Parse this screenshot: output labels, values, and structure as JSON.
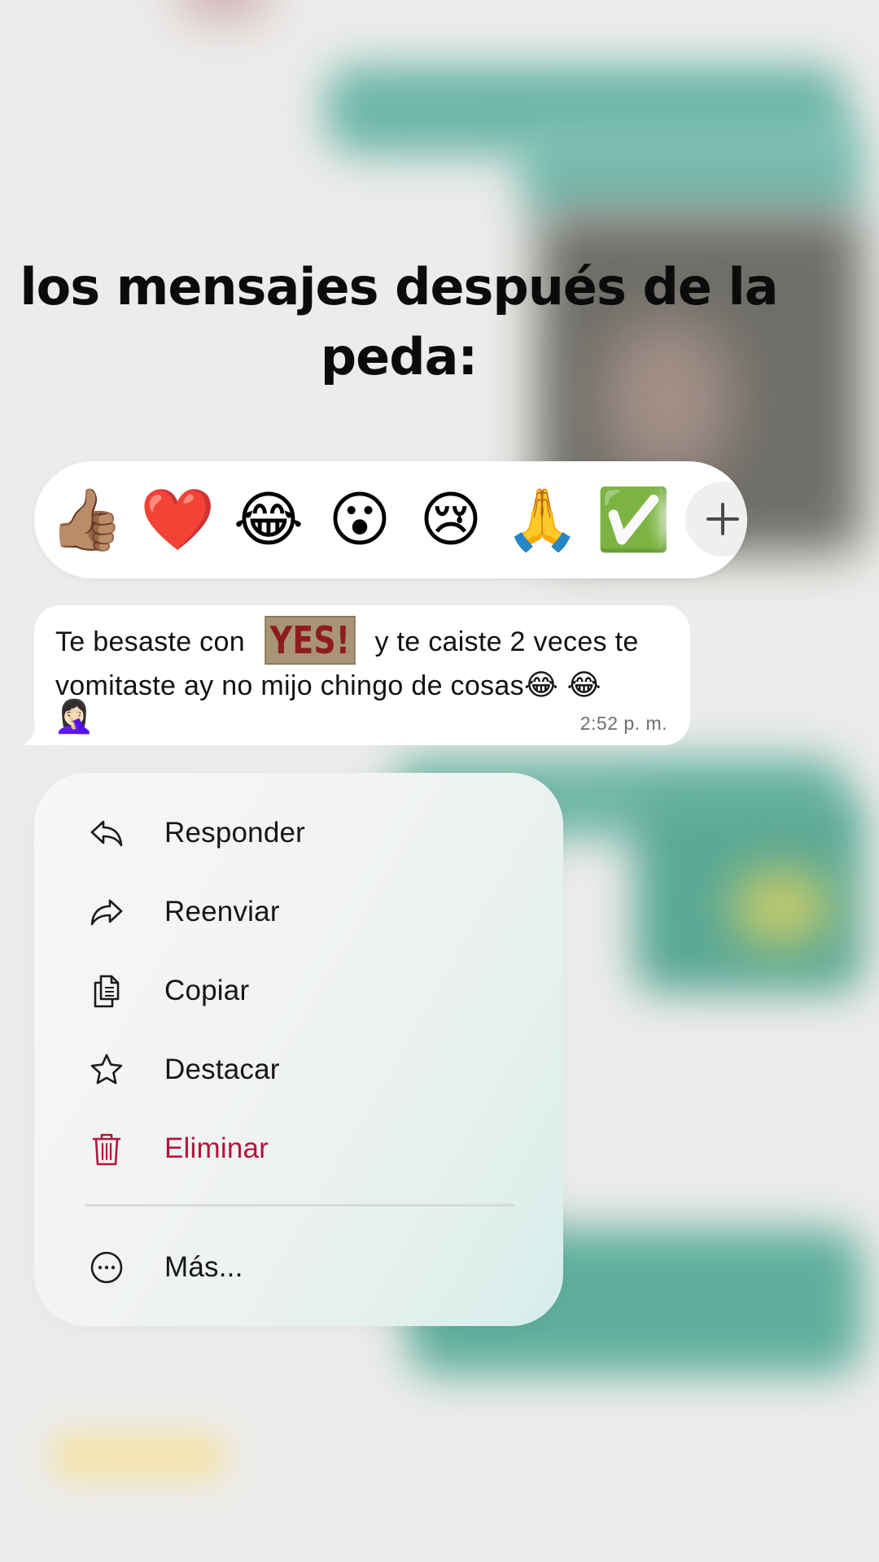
{
  "caption": {
    "line1": "los mensajes después de la",
    "line2": "peda:"
  },
  "reactions": [
    {
      "emoji": "👍🏽",
      "name": "thumbs-up"
    },
    {
      "emoji": "❤️",
      "name": "red-heart"
    },
    {
      "emoji": "😂",
      "name": "tears-of-joy"
    },
    {
      "emoji": "😮",
      "name": "surprised"
    },
    {
      "emoji": "😢",
      "name": "crying"
    },
    {
      "emoji": "🙏",
      "name": "folded-hands"
    },
    {
      "emoji": "✅",
      "name": "check-mark"
    }
  ],
  "reaction_add_icon": "plus-icon",
  "message": {
    "text_before_sticker": "Te besaste con ",
    "sticker_text": "YES!",
    "text_after_sticker": " y te caiste 2 veces te",
    "line2": "vomitaste ay no mijo chingo de cosas",
    "line2_emojis": "😂 😂",
    "line3_emoji": "🤦🏻‍♀️",
    "time": "2:52 p. m."
  },
  "menu": {
    "items": [
      {
        "label": "Responder",
        "icon": "reply-icon"
      },
      {
        "label": "Reenviar",
        "icon": "forward-icon"
      },
      {
        "label": "Copiar",
        "icon": "copy-icon"
      },
      {
        "label": "Destacar",
        "icon": "star-icon"
      },
      {
        "label": "Eliminar",
        "icon": "trash-icon",
        "color": "#b3153c"
      }
    ],
    "more": {
      "label": "Más...",
      "icon": "more-icon"
    }
  },
  "colors": {
    "danger": "#b3153c",
    "background": "#ececea",
    "chat_bubble_green": "#6cb6a8"
  }
}
